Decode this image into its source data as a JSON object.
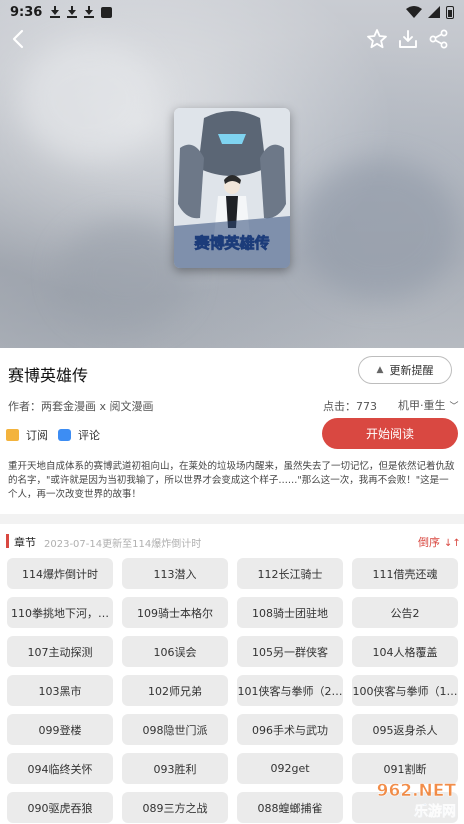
{
  "status_bar": {
    "time": "9:36"
  },
  "toolbar": {
    "back_icon": "back-arrow-icon",
    "favorite_icon": "star-icon",
    "download_icon": "download-icon",
    "share_icon": "share-icon"
  },
  "comic": {
    "title": "赛博英雄传",
    "author": "作者：两套金漫画 x 阅文漫画",
    "clicks": "点击：773",
    "genre": "机甲·重生",
    "cover_title": "赛博英雄传",
    "description": "重开天地自成体系的赛博武道初祖向山，在莱处的垃圾场内醒来，虽然失去了一切记忆，但是依然记着仇敌的名字，\"或许就是因为当初我输了，所以世界才会变成这个样子……\"那么这一次，我再不会败！\"这是一个人，再一次改变世界的故事！"
  },
  "actions": {
    "remind_label": "更新提醒",
    "subscribe_label": "订阅",
    "comment_label": "评论",
    "read_label": "开始阅读"
  },
  "chapters": {
    "header_label": "章节",
    "update_info": "2023-07-14更新至114爆炸倒计时",
    "order_label": "倒序",
    "items": [
      "114爆炸倒计时",
      "113潜入",
      "112长江骑士",
      "111借壳还魂",
      "110拳挑地下河，…",
      "109骑士本格尔",
      "108骑士团驻地",
      "公告2",
      "107主动探测",
      "106误会",
      "105另一群侠客",
      "104人格覆盖",
      "103黑市",
      "102师兄弟",
      "101侠客与拳师（2…",
      "100侠客与拳师（1…",
      "099登楼",
      "098隐世门派",
      "096手术与武功",
      "095返身杀人",
      "094临终关怀",
      "093胜利",
      "092get",
      "091割断",
      "090驱虎吞狼",
      "089三方之战",
      "088蝗螂捕雀",
      ""
    ]
  },
  "watermark": {
    "brand": "962.NET",
    "sub": "乐游网"
  },
  "colors": {
    "accent": "#d94841",
    "chapter_bg": "#ebebeb",
    "hero_bg": "#b9bdc4"
  }
}
